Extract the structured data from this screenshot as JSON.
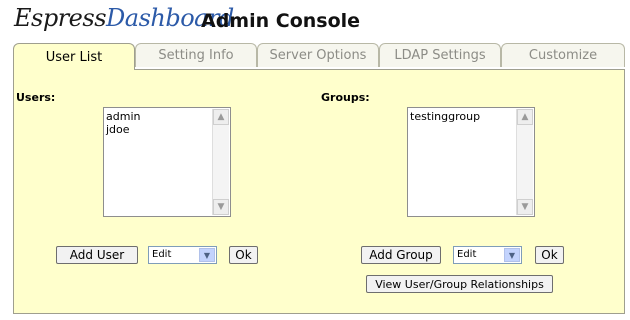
{
  "header": {
    "logo_part1": "Espress",
    "logo_part2": "Dashboard",
    "title": "Admin Console"
  },
  "tabs": [
    {
      "label": "User List",
      "active": true
    },
    {
      "label": "Setting Info",
      "active": false
    },
    {
      "label": "Server Options",
      "active": false
    },
    {
      "label": "LDAP Settings",
      "active": false
    },
    {
      "label": "Customize",
      "active": false
    }
  ],
  "users": {
    "label": "Users:",
    "items": [
      "admin",
      "jdoe"
    ],
    "add_button": "Add User",
    "action_select": "Edit",
    "ok_button": "Ok"
  },
  "groups": {
    "label": "Groups:",
    "items": [
      "testinggroup"
    ],
    "add_button": "Add Group",
    "action_select": "Edit",
    "ok_button": "Ok",
    "relationships_button": "View User/Group Relationships"
  },
  "colors": {
    "panel_bg": "#ffffcc",
    "logo_blue": "#2c5aa8",
    "select_button": "#c3d3fd"
  },
  "icons": {
    "scroll_up": "scroll-up-arrow-icon",
    "scroll_down": "scroll-down-arrow-icon",
    "dropdown": "chevron-down-icon"
  }
}
